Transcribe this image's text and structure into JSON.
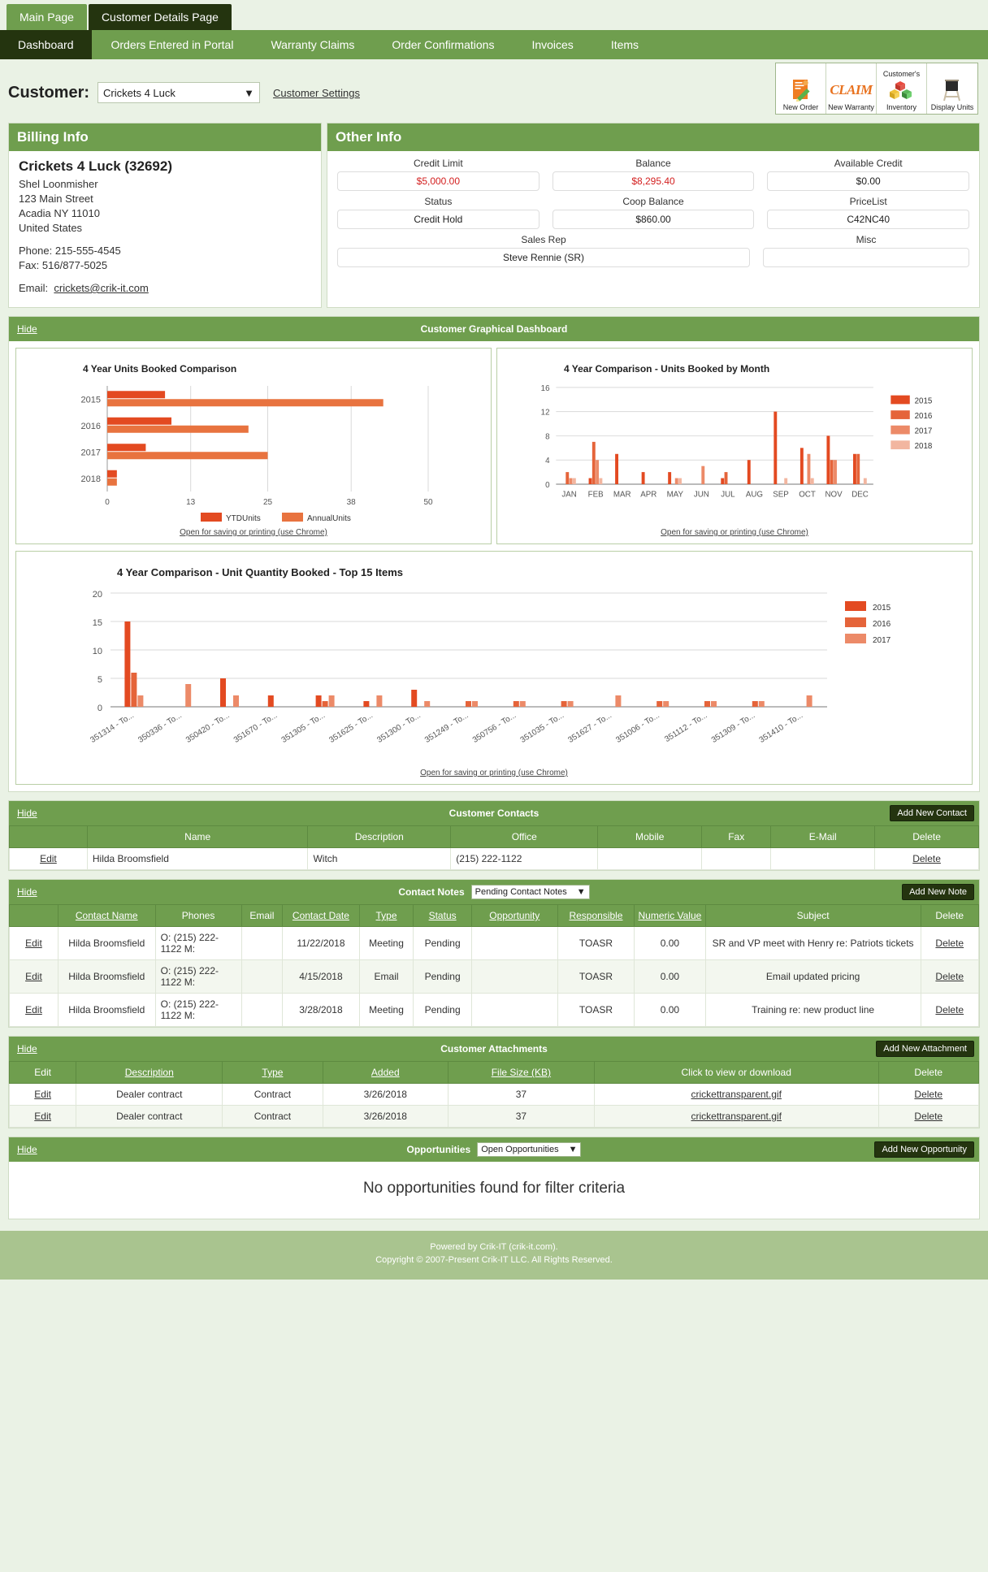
{
  "page_tabs": [
    {
      "label": "Main Page",
      "active": false
    },
    {
      "label": "Customer Details Page",
      "active": true
    }
  ],
  "section_tabs": [
    {
      "label": "Dashboard",
      "active": true
    },
    {
      "label": "Orders Entered in Portal",
      "active": false
    },
    {
      "label": "Warranty Claims",
      "active": false
    },
    {
      "label": "Order Confirmations",
      "active": false
    },
    {
      "label": "Invoices",
      "active": false
    },
    {
      "label": "Items",
      "active": false
    }
  ],
  "customer_bar": {
    "label": "Customer:",
    "selected": "Crickets 4 Luck",
    "settings_link": "Customer Settings"
  },
  "toolbar": [
    {
      "top": "",
      "label": "New Order",
      "icon": "new-order-icon"
    },
    {
      "top": "",
      "label": "New Warranty",
      "icon": "claim-icon"
    },
    {
      "top": "Customer's",
      "label": "Inventory",
      "icon": "inventory-icon"
    },
    {
      "top": "",
      "label": "Display Units",
      "icon": "display-units-icon"
    }
  ],
  "billing": {
    "header": "Billing Info",
    "name": "Crickets 4 Luck (32692)",
    "contact": "Shel Loonmisher",
    "street": "123 Main Street",
    "city_state_zip": "Acadia NY 11010",
    "country": "United States",
    "phone": "Phone: 215-555-4545",
    "fax": "Fax: 516/877-5025",
    "email_label": "Email:",
    "email": "crickets@crik-it.com"
  },
  "other_info": {
    "header": "Other Info",
    "credit_limit_label": "Credit Limit",
    "credit_limit": "$5,000.00",
    "balance_label": "Balance",
    "balance": "$8,295.40",
    "available_credit_label": "Available Credit",
    "available_credit": "$0.00",
    "status_label": "Status",
    "status": "Credit Hold",
    "coop_balance_label": "Coop Balance",
    "coop_balance": "$860.00",
    "pricelist_label": "PriceList",
    "pricelist": "C42NC40",
    "sales_rep_label": "Sales Rep",
    "sales_rep": "Steve Rennie (SR)",
    "misc_label": "Misc",
    "misc": ""
  },
  "dashboard": {
    "hide": "Hide",
    "title": "Customer Graphical Dashboard",
    "open_link": "Open for saving or printing (use Chrome)"
  },
  "chart_data": [
    {
      "type": "bar",
      "orientation": "horizontal",
      "title": "4 Year Units Booked Comparison",
      "categories": [
        "2015",
        "2016",
        "2017",
        "2018"
      ],
      "series": [
        {
          "name": "YTDUnits",
          "color": "#e34a21",
          "values": [
            9,
            10,
            6,
            1.5
          ]
        },
        {
          "name": "AnnualUnits",
          "color": "#e8733f",
          "values": [
            43,
            22,
            25,
            1.5
          ]
        }
      ],
      "xlabel": "",
      "ylabel": "",
      "xlim": [
        0,
        50
      ],
      "xticks": [
        0,
        13,
        25,
        38,
        50
      ],
      "grid": true,
      "legend_position": "bottom"
    },
    {
      "type": "bar",
      "orientation": "vertical",
      "title": "4 Year Comparison - Units Booked by Month",
      "categories": [
        "JAN",
        "FEB",
        "MAR",
        "APR",
        "MAY",
        "JUN",
        "JUL",
        "AUG",
        "SEP",
        "OCT",
        "NOV",
        "DEC"
      ],
      "series": [
        {
          "name": "2015",
          "color": "#e34a21",
          "values": [
            0,
            1,
            5,
            2,
            2,
            0,
            1,
            4,
            12,
            6,
            8,
            5
          ]
        },
        {
          "name": "2016",
          "color": "#e5643a",
          "values": [
            2,
            7,
            0,
            0,
            0,
            0,
            2,
            0,
            0,
            0,
            4,
            5
          ]
        },
        {
          "name": "2017",
          "color": "#ec8a68",
          "values": [
            1,
            4,
            0,
            0,
            1,
            3,
            0,
            0,
            0,
            5,
            4,
            0
          ]
        },
        {
          "name": "2018",
          "color": "#f2b6a0",
          "values": [
            1,
            1,
            0,
            0,
            1,
            0,
            0,
            0,
            1,
            1,
            0,
            1
          ]
        }
      ],
      "ylim": [
        0,
        16
      ],
      "yticks": [
        0,
        4,
        8,
        12,
        16
      ],
      "grid": true,
      "legend_position": "right"
    },
    {
      "type": "bar",
      "orientation": "vertical",
      "title": "4 Year Comparison - Unit Quantity Booked - Top 15 Items",
      "categories": [
        "351314 - To...",
        "350336 - To...",
        "350420 - To...",
        "351670 - To...",
        "351305 - To...",
        "351625 - To...",
        "351300 - To...",
        "351249 - To...",
        "350756 - To...",
        "351035 - To...",
        "351627 - To...",
        "351006 - To...",
        "351112 - To...",
        "351309 - To...",
        "351410 - To..."
      ],
      "series": [
        {
          "name": "2015",
          "color": "#e34a21",
          "values": [
            15,
            0,
            5,
            2,
            2,
            1,
            3,
            0,
            0,
            0,
            0,
            0,
            0,
            0,
            0
          ]
        },
        {
          "name": "2016",
          "color": "#e5643a",
          "values": [
            6,
            0,
            0,
            0,
            1,
            0,
            0,
            1,
            1,
            1,
            0,
            1,
            1,
            1,
            0
          ]
        },
        {
          "name": "2017",
          "color": "#ec8a68",
          "values": [
            2,
            4,
            2,
            0,
            2,
            2,
            1,
            1,
            1,
            1,
            2,
            1,
            1,
            1,
            2
          ]
        }
      ],
      "ylim": [
        0,
        20
      ],
      "yticks": [
        0,
        5,
        10,
        15,
        20
      ],
      "grid": true,
      "legend_position": "right"
    }
  ],
  "contacts": {
    "hide": "Hide",
    "title": "Customer Contacts",
    "add_button": "Add New Contact",
    "columns": [
      "",
      "Name",
      "Description",
      "Office",
      "Mobile",
      "Fax",
      "E-Mail",
      "Delete"
    ],
    "rows": [
      {
        "edit": "Edit",
        "name": "Hilda Broomsfield",
        "description": "Witch",
        "office": "(215) 222-1122",
        "mobile": "",
        "fax": "",
        "email": "",
        "delete": "Delete"
      }
    ]
  },
  "contact_notes": {
    "hide": "Hide",
    "title": "Contact Notes",
    "filter": "Pending Contact Notes",
    "add_button": "Add New Note",
    "columns": [
      "",
      "Contact Name",
      "Phones",
      "Email",
      "Contact Date",
      "Type",
      "Status",
      "Opportunity",
      "Responsible",
      "Numeric Value",
      "Subject",
      "Delete"
    ],
    "rows": [
      {
        "edit": "Edit",
        "contact_name": "Hilda Broomsfield",
        "phones": "O: (215) 222-1122 M:",
        "email": "",
        "contact_date": "11/22/2018",
        "type": "Meeting",
        "status": "Pending",
        "opportunity": "",
        "responsible": "TOASR",
        "numeric_value": "0.00",
        "subject": "SR and VP meet with Henry re: Patriots tickets",
        "delete": "Delete"
      },
      {
        "edit": "Edit",
        "contact_name": "Hilda Broomsfield",
        "phones": "O: (215) 222-1122 M:",
        "email": "",
        "contact_date": "4/15/2018",
        "type": "Email",
        "status": "Pending",
        "opportunity": "",
        "responsible": "TOASR",
        "numeric_value": "0.00",
        "subject": "Email updated pricing",
        "delete": "Delete"
      },
      {
        "edit": "Edit",
        "contact_name": "Hilda Broomsfield",
        "phones": "O: (215) 222-1122 M:",
        "email": "",
        "contact_date": "3/28/2018",
        "type": "Meeting",
        "status": "Pending",
        "opportunity": "",
        "responsible": "TOASR",
        "numeric_value": "0.00",
        "subject": "Training re: new product line",
        "delete": "Delete"
      }
    ]
  },
  "attachments": {
    "hide": "Hide",
    "title": "Customer Attachments",
    "add_button": "Add New Attachment",
    "columns": [
      "Edit",
      "Description",
      "Type",
      "Added",
      "File Size (KB)",
      "Click to view or download",
      "Delete"
    ],
    "rows": [
      {
        "edit": "Edit",
        "description": "Dealer contract",
        "type": "Contract",
        "added": "3/26/2018",
        "size": "37",
        "file": "crickettransparent.gif",
        "delete": "Delete"
      },
      {
        "edit": "Edit",
        "description": "Dealer contract",
        "type": "Contract",
        "added": "3/26/2018",
        "size": "37",
        "file": "crickettransparent.gif",
        "delete": "Delete"
      }
    ]
  },
  "opportunities": {
    "hide": "Hide",
    "title": "Opportunities",
    "filter": "Open Opportunities",
    "add_button": "Add New Opportunity",
    "empty_message": "No opportunities found for filter criteria"
  },
  "footer": {
    "line1": "Powered by Crik-IT (crik-it.com).",
    "line2": "Copyright © 2007-Present Crik-IT LLC. All Rights Reserved."
  }
}
